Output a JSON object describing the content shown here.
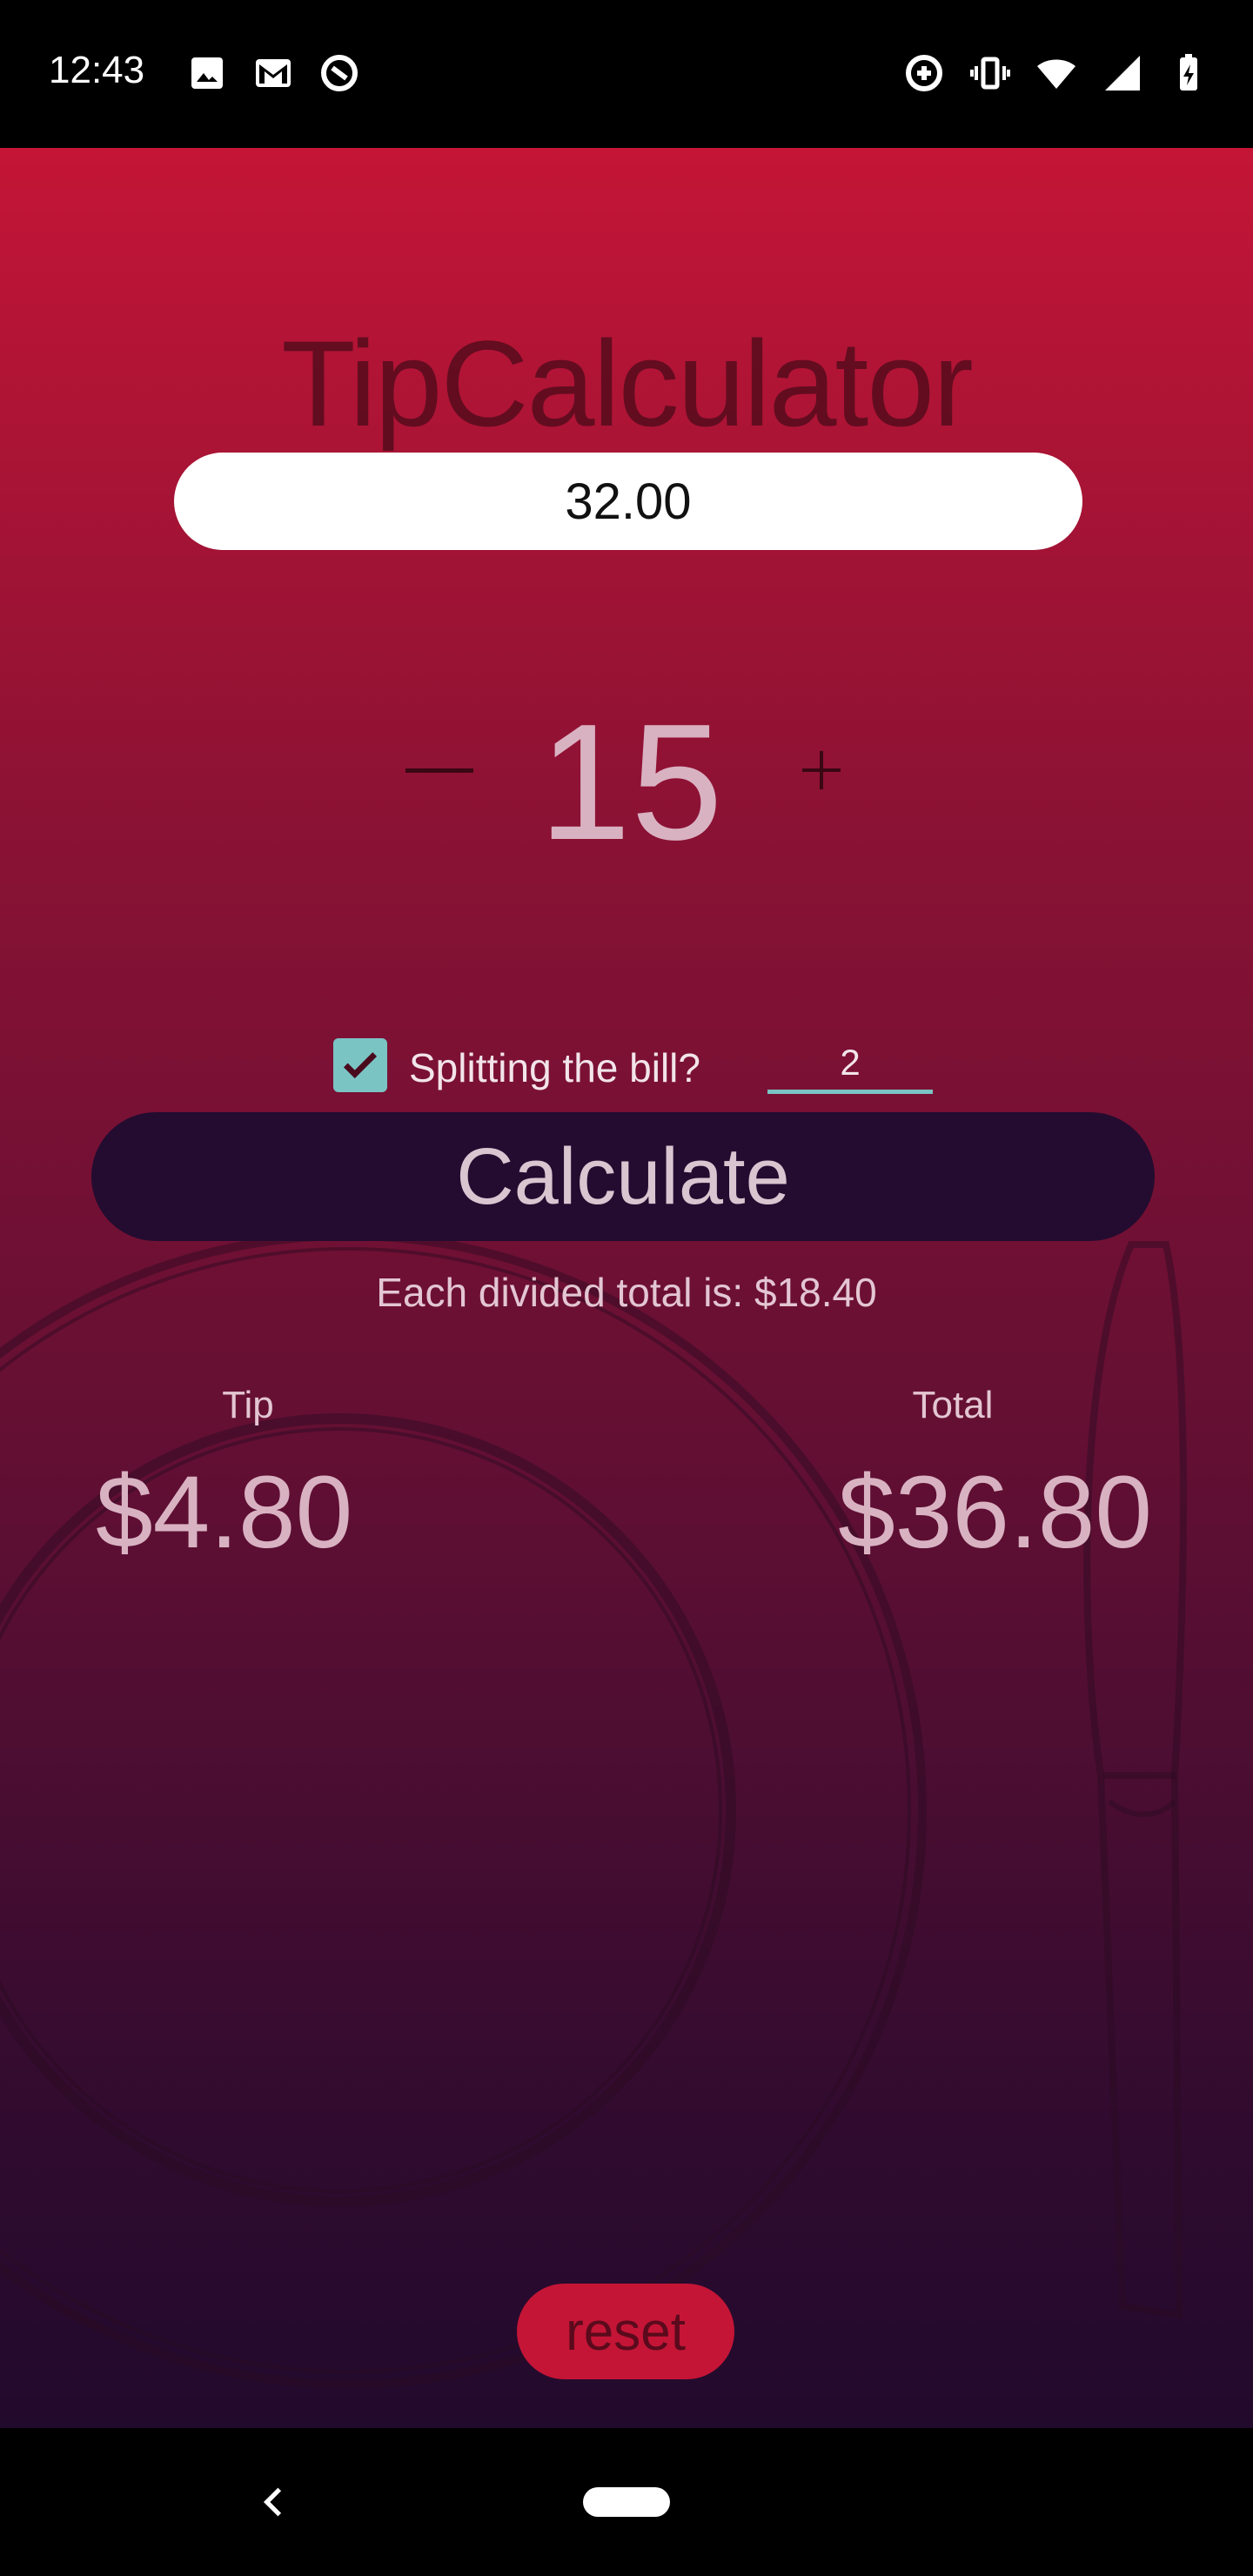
{
  "status_bar": {
    "time": "12:43",
    "left_icons": [
      "image-icon",
      "gmail-icon",
      "sync-icon"
    ],
    "right_icons": [
      "data-saver-icon",
      "vibrate-icon",
      "wifi-icon",
      "signal-icon",
      "battery-charging-icon"
    ]
  },
  "app": {
    "title": "TipCalculator",
    "bill_amount": "32.00",
    "tip_percent": "15",
    "split": {
      "label": "Splitting the bill?",
      "checked": true,
      "people": "2"
    },
    "calculate_label": "Calculate",
    "each_total_text": "Each divided total is: $18.40",
    "tip_label": "Tip",
    "tip_amount": "$4.80",
    "total_label": "Total",
    "total_amount": "$36.80",
    "reset_label": "reset"
  },
  "colors": {
    "gradient_top": "#c41536",
    "gradient_bottom": "#220a2c",
    "calculate_button": "#230c30",
    "accent_teal": "#7ac4c4",
    "reset_button": "#c41536"
  },
  "nav_bar": {
    "icons": [
      "back-icon",
      "home-pill-icon"
    ]
  }
}
